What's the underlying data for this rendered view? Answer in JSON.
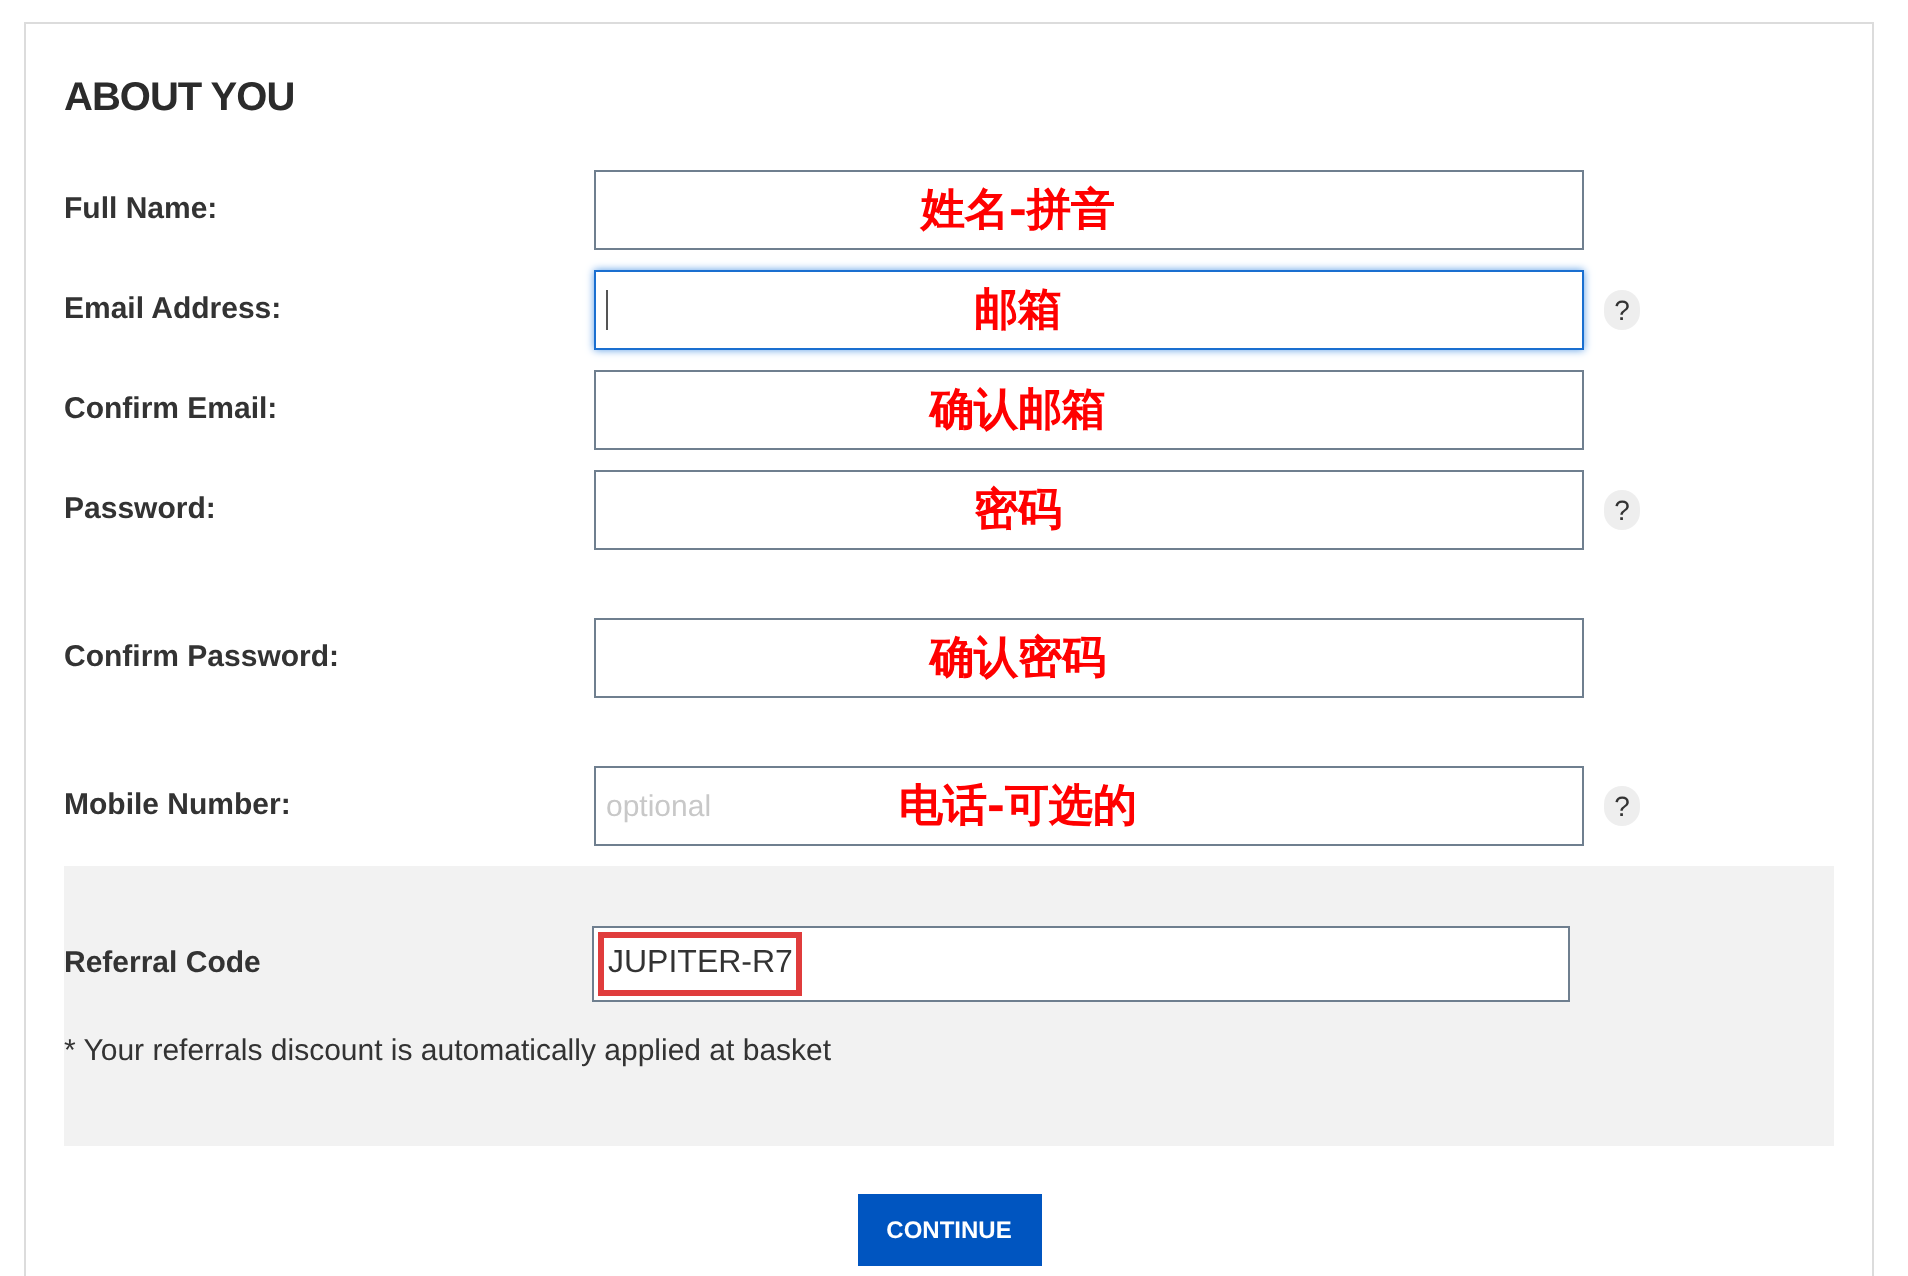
{
  "title": "ABOUT YOU",
  "fields": [
    {
      "label": "Full Name:",
      "annotation": "姓名-拼音",
      "focused": false
    },
    {
      "label": "Email Address:",
      "annotation": "邮箱",
      "focused": true,
      "help": "?"
    },
    {
      "label": "Confirm Email:",
      "annotation": "确认邮箱",
      "focused": false
    },
    {
      "label": "Password:",
      "annotation": "密码",
      "focused": false,
      "help": "?"
    },
    {
      "label": "Confirm Password:",
      "annotation": "确认密码",
      "focused": false
    },
    {
      "label": "Mobile Number:",
      "annotation": "电话-可选的",
      "placeholder": "optional",
      "focused": false,
      "help": "?"
    }
  ],
  "referral": {
    "label": "Referral Code",
    "value": "JUPITER-R7",
    "highlighted": true,
    "note": "* Your referrals discount is automatically applied at basket"
  },
  "button": "CONTINUE"
}
